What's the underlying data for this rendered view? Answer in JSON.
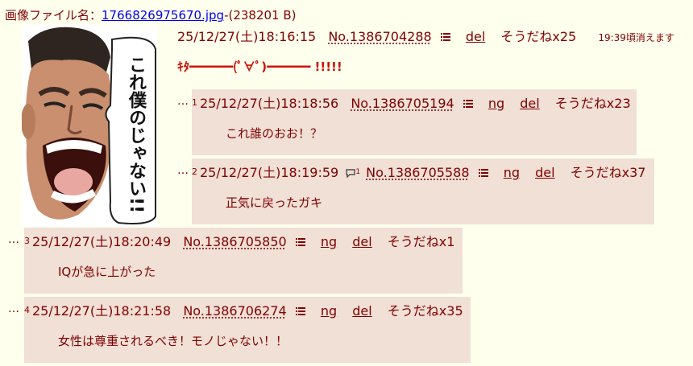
{
  "file": {
    "label": "画像ファイル名：",
    "name": "1766826975670.jpg",
    "size": "-(238201 B)"
  },
  "thumbnail": {
    "speech_text": "これ僕のじゃない!!"
  },
  "op": {
    "date": "25/12/27(土)18:16:15",
    "number": "No.1386704288",
    "del": "del",
    "soudane": "そうだねx25",
    "expire": "19:39頃消えます",
    "body": "ｷﾀ━━━━━━(ﾟ∀ﾟ)━━━━━━ !!!!!"
  },
  "replies": [
    {
      "index": "1",
      "date": "25/12/27(土)18:18:56",
      "number": "No.1386705194",
      "ng": "ng",
      "del": "del",
      "soudane": "そうだねx23",
      "body": "これ誰のおお！？"
    },
    {
      "index": "2",
      "date": "25/12/27(土)18:19:59",
      "quote_count": "1",
      "number": "No.1386705588",
      "ng": "ng",
      "del": "del",
      "soudane": "そうだねx37",
      "body": "正気に戻ったガキ"
    },
    {
      "index": "3",
      "date": "25/12/27(土)18:20:49",
      "number": "No.1386705850",
      "ng": "ng",
      "del": "del",
      "soudane": "そうだねx1",
      "body": "IQが急に上がった"
    },
    {
      "index": "4",
      "date": "25/12/27(土)18:21:58",
      "number": "No.1386706274",
      "ng": "ng",
      "del": "del",
      "soudane": "そうだねx35",
      "body": "女性は尊重されるべき！モノじゃない！！"
    }
  ],
  "ellipsis": "…",
  "colors": {
    "background": "#ffffee",
    "reply_background": "#f0e0d6",
    "text": "#800000",
    "link": "#0000ee",
    "op_body": "#cc1105"
  }
}
